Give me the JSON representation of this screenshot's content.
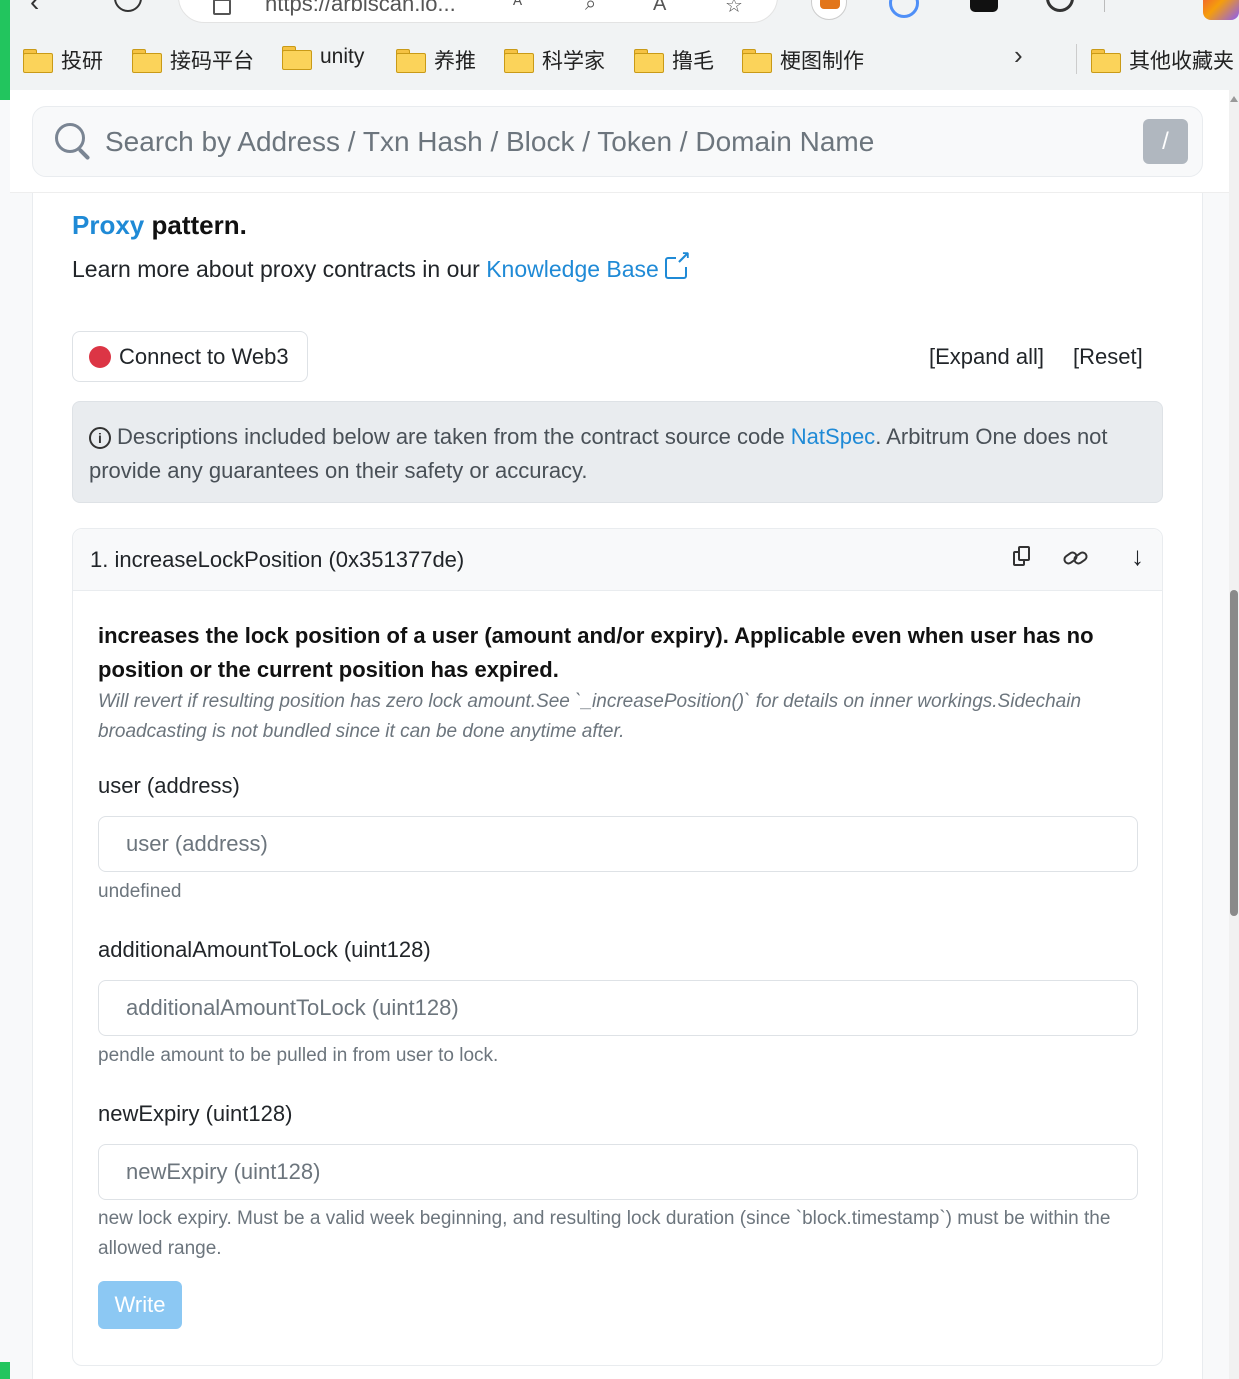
{
  "browser": {
    "url": "https://arbiscan.io...",
    "bookmarks": [
      "投研",
      "接码平台",
      "unity",
      "养推",
      "科学家",
      "撸毛",
      "梗图制作"
    ],
    "more_bookmarks": "其他收藏夹"
  },
  "search": {
    "placeholder": "Search by Address / Txn Hash / Block / Token / Domain Name",
    "shortcut": "/"
  },
  "intro": {
    "proxy_link": "Proxy",
    "proxy_suffix": " pattern.",
    "learn_prefix": "Learn more about proxy contracts in our ",
    "learn_link": "Knowledge Base"
  },
  "controls": {
    "connect_label": "Connect to Web3",
    "expand_all": "[Expand all]",
    "reset": "[Reset]"
  },
  "notice": {
    "prefix": "Descriptions included below are taken from the contract source code ",
    "link": "NatSpec",
    "suffix": ". Arbitrum One does not provide any guarantees on their safety or accuracy."
  },
  "function": {
    "title": "1. increaseLockPosition (0x351377de)",
    "description": "increases the lock position of a user (amount and/or expiry). Applicable even when user has no position or the current position has expired.",
    "note": "Will revert if resulting position has zero lock amount.See `_increasePosition()` for details on inner workings.Sidechain broadcasting is not bundled since it can be done anytime after.",
    "params": [
      {
        "label": "user (address)",
        "placeholder": "user (address)",
        "value": "",
        "help": "undefined"
      },
      {
        "label": "additionalAmountToLock (uint128)",
        "placeholder": "additionalAmountToLock (uint128)",
        "value": "",
        "help": "pendle amount to be pulled in from user to lock."
      },
      {
        "label": "newExpiry (uint128)",
        "placeholder": "newExpiry (uint128)",
        "value": "",
        "help": "new lock expiry. Must be a valid week beginning, and resulting lock duration (since `block.timestamp`) must be within the allowed range."
      }
    ],
    "write_label": "Write"
  },
  "colors": {
    "link": "#1f8ad6",
    "status_dot": "#dc3545",
    "write_button": "#8cc8f3"
  }
}
